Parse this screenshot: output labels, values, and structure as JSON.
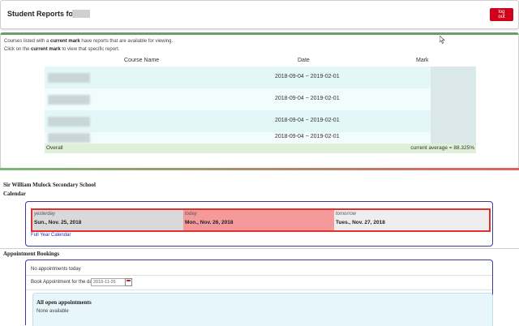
{
  "header": {
    "title": "Student Reports for",
    "logout_label": "log out"
  },
  "reports": {
    "note_line1_pre": "Courses listed with a ",
    "note_line1_bold": "current mark",
    "note_line1_post": " have reports that are available for viewing.",
    "note_line2_pre": "Click on the ",
    "note_line2_bold": "current mark",
    "note_line2_post": " to view that specific report.",
    "columns": [
      "Course Name",
      "Date",
      "Mark"
    ],
    "rows": [
      {
        "date": "2018-09-04 ~ 2019-02-01"
      },
      {
        "date": "2018-09-04 ~ 2019-02-01"
      },
      {
        "date": "2018-09-04 ~ 2019-02-01"
      },
      {
        "date": "2018-09-04 ~ 2019-02-01"
      }
    ],
    "overall_label": "Overall",
    "current_average": "current average = 88.325%"
  },
  "school": {
    "name": "Sir William Mulock Secondary School",
    "calendar_header": "Calendar",
    "days": [
      {
        "label": "yesterday",
        "date": "Sun., Nov. 25, 2018",
        "bg": "#d9d9d9"
      },
      {
        "label": "today",
        "date": "Mon., Nov. 26, 2018",
        "bg": "#f59a9a"
      },
      {
        "label": "tomorrow",
        "date": "Tues., Nov. 27, 2018",
        "bg": "#eeeeee"
      }
    ],
    "full_calendar_link": "Full Year Calendar"
  },
  "appointments": {
    "header": "Appointment Bookings",
    "none_today": "No appointments today",
    "book_label": "Book Appointment for the date",
    "date_value": "2018-11-26",
    "open_title": "All open appointments",
    "open_none": "None available"
  },
  "colors": {
    "logout_bg": "#d0021b",
    "today_border": "#e03030",
    "link": "#2a2ab8"
  }
}
